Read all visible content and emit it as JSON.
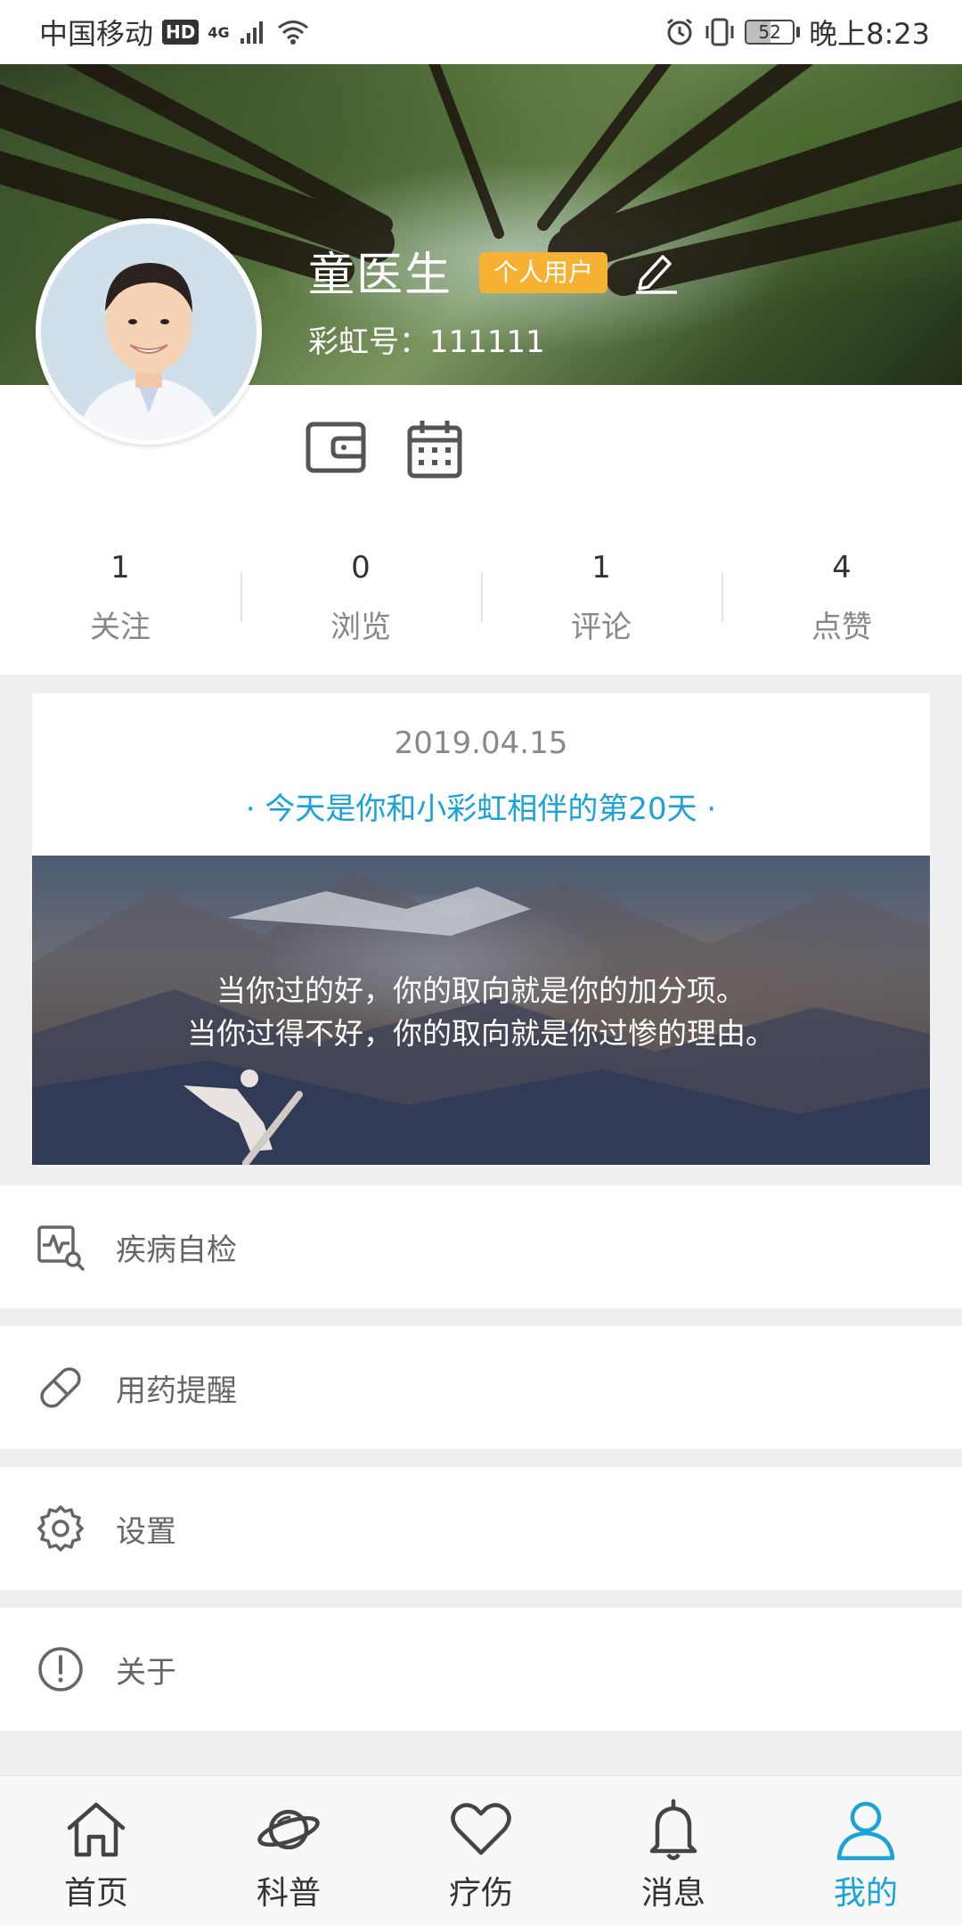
{
  "status_bar": {
    "carrier": "中国移动",
    "hd_badge": "HD",
    "network": "4G",
    "battery_level": 52,
    "battery_text": "52",
    "time": "晚上8:23"
  },
  "profile": {
    "name": "童医生",
    "tag": "个人用户",
    "id_text": "彩虹号：111111"
  },
  "stats": [
    {
      "value": "1",
      "label": "关注"
    },
    {
      "value": "0",
      "label": "浏览"
    },
    {
      "value": "1",
      "label": "评论"
    },
    {
      "value": "4",
      "label": "点赞"
    }
  ],
  "daily": {
    "date": "2019.04.15",
    "message": "· 今天是你和小彩虹相伴的第20天 ·",
    "quote_line1": "当你过的好，你的取向就是你的加分项。",
    "quote_line2": "当你过得不好，你的取向就是你过惨的理由。"
  },
  "menu": [
    {
      "icon": "health-check-icon",
      "label": "疾病自检"
    },
    {
      "icon": "pill-icon",
      "label": "用药提醒"
    },
    {
      "icon": "gear-icon",
      "label": "设置"
    },
    {
      "icon": "info-icon",
      "label": "关于"
    }
  ],
  "nav": [
    {
      "icon": "home-icon",
      "label": "首页"
    },
    {
      "icon": "planet-icon",
      "label": "科普"
    },
    {
      "icon": "heart-icon",
      "label": "疗伤"
    },
    {
      "icon": "bell-icon",
      "label": "消息"
    },
    {
      "icon": "user-icon",
      "label": "我的",
      "active": true
    }
  ],
  "colors": {
    "accent": "#1aa2dc",
    "tag": "#f7b234",
    "background": "#efefef"
  }
}
